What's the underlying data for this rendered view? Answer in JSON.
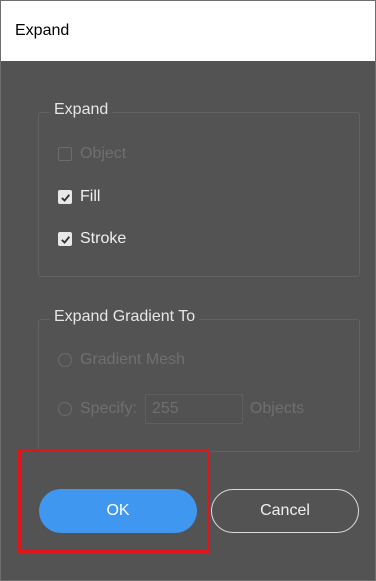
{
  "window": {
    "title": "Expand"
  },
  "expand_group": {
    "label": "Expand",
    "object": {
      "label": "Object",
      "checked": false,
      "enabled": false
    },
    "fill": {
      "label": "Fill",
      "checked": true,
      "enabled": true
    },
    "stroke": {
      "label": "Stroke",
      "checked": true,
      "enabled": true
    }
  },
  "gradient_group": {
    "label": "Expand Gradient To",
    "gradient_mesh": {
      "label": "Gradient Mesh",
      "enabled": false
    },
    "specify": {
      "label": "Specify:",
      "value": "255",
      "unit": "Objects",
      "enabled": false
    }
  },
  "buttons": {
    "ok": "OK",
    "cancel": "Cancel"
  },
  "colors": {
    "dialog_bg": "#535353",
    "accent": "#3f97f0",
    "highlight": "#e0141a"
  }
}
